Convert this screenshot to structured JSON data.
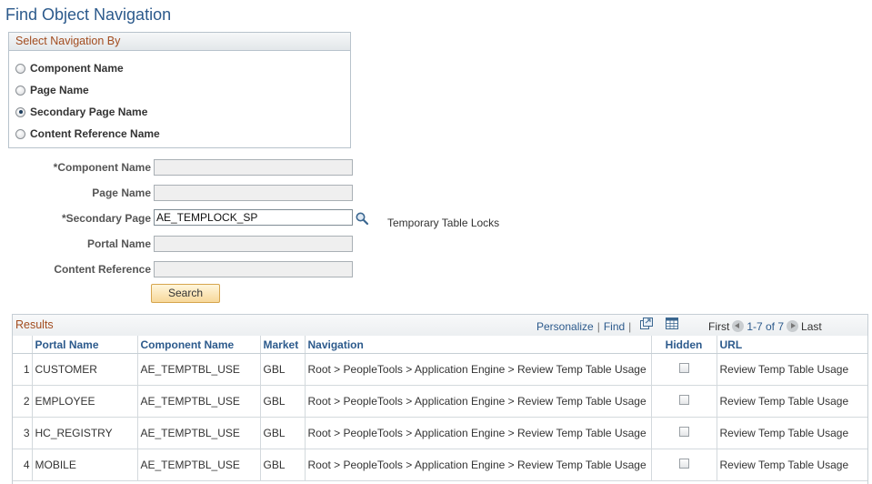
{
  "page": {
    "title": "Find Object Navigation"
  },
  "nav_box": {
    "header": "Select Navigation By",
    "options": [
      {
        "label": "Component Name",
        "selected": false
      },
      {
        "label": "Page Name",
        "selected": false
      },
      {
        "label": "Secondary Page Name",
        "selected": true
      },
      {
        "label": "Content Reference Name",
        "selected": false
      }
    ]
  },
  "form": {
    "component_name": {
      "label": "*Component Name",
      "value": ""
    },
    "page_name": {
      "label": "Page Name",
      "value": ""
    },
    "secondary_page": {
      "label": "*Secondary Page",
      "value": "AE_TEMPLOCK_SP",
      "description": "Temporary Table Locks"
    },
    "portal_name": {
      "label": "Portal Name",
      "value": ""
    },
    "content_reference": {
      "label": "Content Reference",
      "value": ""
    },
    "search_label": "Search"
  },
  "results": {
    "title": "Results",
    "personalize": "Personalize",
    "find": "Find",
    "pager": {
      "first": "First",
      "range": "1-7 of 7",
      "last": "Last"
    },
    "columns": [
      "",
      "Portal Name",
      "Component Name",
      "Market",
      "Navigation",
      "Hidden",
      "URL"
    ],
    "rows": [
      {
        "num": "1",
        "portal": "CUSTOMER",
        "component": "AE_TEMPTBL_USE",
        "market": "GBL",
        "navigation": "Root > PeopleTools > Application Engine > Review Temp Table Usage",
        "hidden": false,
        "url": "Review Temp Table Usage"
      },
      {
        "num": "2",
        "portal": "EMPLOYEE",
        "component": "AE_TEMPTBL_USE",
        "market": "GBL",
        "navigation": "Root > PeopleTools > Application Engine > Review Temp Table Usage",
        "hidden": false,
        "url": "Review Temp Table Usage"
      },
      {
        "num": "3",
        "portal": "HC_REGISTRY",
        "component": "AE_TEMPTBL_USE",
        "market": "GBL",
        "navigation": "Root > PeopleTools > Application Engine > Review Temp Table Usage",
        "hidden": false,
        "url": "Review Temp Table Usage"
      },
      {
        "num": "4",
        "portal": "MOBILE",
        "component": "AE_TEMPTBL_USE",
        "market": "GBL",
        "navigation": "Root > PeopleTools > Application Engine > Review Temp Table Usage",
        "hidden": false,
        "url": "Review Temp Table Usage"
      }
    ]
  }
}
